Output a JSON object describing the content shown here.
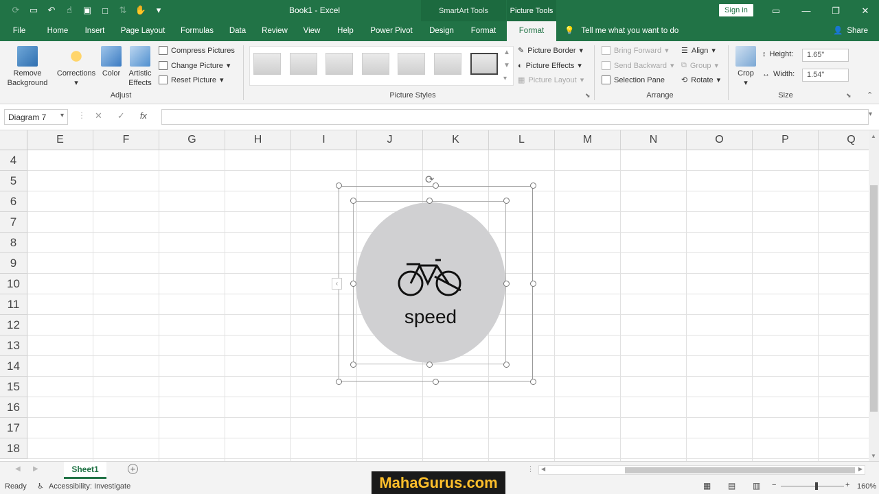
{
  "app": {
    "title": "Book1 - Excel",
    "context_smartart": "SmartArt Tools",
    "context_picture": "Picture Tools",
    "sign_in": "Sign in"
  },
  "tabs": [
    "File",
    "Home",
    "Insert",
    "Page Layout",
    "Formulas",
    "Data",
    "Review",
    "View",
    "Help",
    "Power Pivot",
    "Design",
    "Format"
  ],
  "active_tab": "Format",
  "tell_me": "Tell me what you want to do",
  "share": "Share",
  "ribbon": {
    "adjust": {
      "remove_background": "Remove Background",
      "corrections": "Corrections",
      "color": "Color",
      "artistic_effects": "Artistic Effects",
      "compress": "Compress Pictures",
      "change": "Change Picture",
      "reset": "Reset Picture",
      "group": "Adjust"
    },
    "styles": {
      "picture_border": "Picture Border",
      "picture_effects": "Picture Effects",
      "picture_layout": "Picture Layout",
      "group": "Picture Styles"
    },
    "arrange": {
      "bring_forward": "Bring Forward",
      "send_backward": "Send Backward",
      "selection_pane": "Selection Pane",
      "align": "Align",
      "group_btn": "Group",
      "rotate": "Rotate",
      "group": "Arrange"
    },
    "size": {
      "crop": "Crop",
      "height_label": "Height:",
      "height_value": "1.65\"",
      "width_label": "Width:",
      "width_value": "1.54\"",
      "group": "Size"
    }
  },
  "formula_bar": {
    "name_box": "Diagram 7",
    "fx": "fx",
    "value": ""
  },
  "columns": [
    "E",
    "F",
    "G",
    "H",
    "I",
    "J",
    "K",
    "L",
    "M",
    "N",
    "O",
    "P",
    "Q"
  ],
  "rows": [
    "4",
    "5",
    "6",
    "7",
    "8",
    "9",
    "10",
    "11",
    "12",
    "13",
    "14",
    "15",
    "16",
    "17",
    "18"
  ],
  "diagram": {
    "label": "speed",
    "icon": "bike-icon",
    "fill": "#d0d0d2"
  },
  "sheet": {
    "name": "Sheet1"
  },
  "status": {
    "ready": "Ready",
    "accessibility": "Accessibility: Investigate",
    "zoom": "160%"
  },
  "watermark": "MahaGurus.com",
  "colors": {
    "accent": "#217346"
  }
}
